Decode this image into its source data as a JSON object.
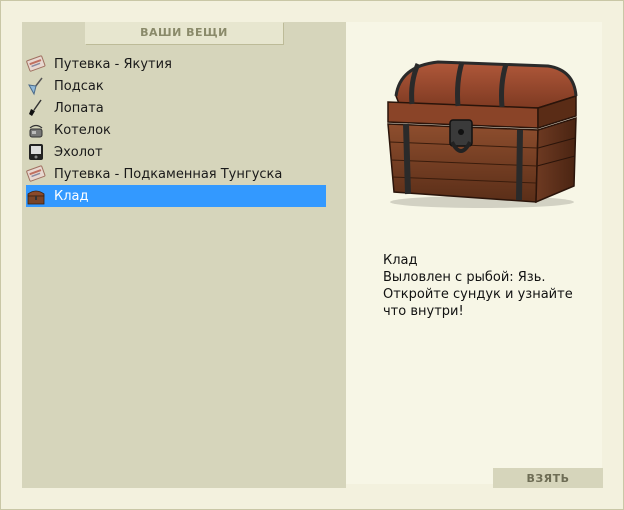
{
  "inventory": {
    "title": "ВАШИ ВЕЩИ",
    "items": [
      {
        "label": "Путевка - Якутия",
        "icon": "voucher-icon"
      },
      {
        "label": "Подсак",
        "icon": "landing-net-icon"
      },
      {
        "label": "Лопата",
        "icon": "shovel-icon"
      },
      {
        "label": "Котелок",
        "icon": "kettle-icon"
      },
      {
        "label": "Эхолот",
        "icon": "echo-sounder-icon"
      },
      {
        "label": "Путевка - Подкаменная Тунгуска",
        "icon": "voucher-icon"
      },
      {
        "label": "Клад",
        "icon": "treasure-chest-icon",
        "selected": true
      }
    ]
  },
  "detail": {
    "image": "treasure-chest",
    "name": "Клад",
    "line1": "Выловлен с рыбой: Язь.",
    "line2": "Откройте сундук и узнайте",
    "line3": "что внутри!"
  },
  "actions": {
    "take_label": "ВЗЯТЬ"
  },
  "colors": {
    "selection": "#3399ff",
    "panel": "#d6d5bb",
    "background": "#f3f1de"
  }
}
